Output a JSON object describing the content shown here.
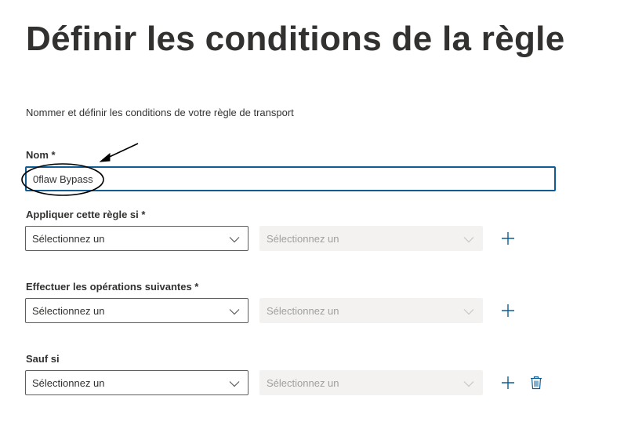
{
  "page": {
    "title": "Définir les conditions de la règle",
    "subtitle": "Nommer et définir les conditions de votre règle de transport"
  },
  "name_field": {
    "label": "Nom *",
    "value": "0flaw Bypass"
  },
  "apply_if": {
    "label": "Appliquer cette règle si *",
    "primary_select": "Sélectionnez un",
    "secondary_select": "Sélectionnez un"
  },
  "do_actions": {
    "label": "Effectuer les opérations suivantes *",
    "primary_select": "Sélectionnez un",
    "secondary_select": "Sélectionnez un"
  },
  "except_if": {
    "label": "Sauf si",
    "primary_select": "Sélectionnez un",
    "secondary_select": "Sélectionnez un"
  },
  "icons": {
    "add": "plus-icon",
    "delete": "trash-icon",
    "dropdown": "chevron-down-icon",
    "annotation_arrow": "arrow-icon",
    "annotation_circle": "circle-annotation"
  },
  "colors": {
    "accent": "#0f5d93",
    "icon_blue": "#0f5d93",
    "text": "#323130",
    "disabled_bg": "#f3f2f1",
    "disabled_text": "#a19f9d"
  }
}
